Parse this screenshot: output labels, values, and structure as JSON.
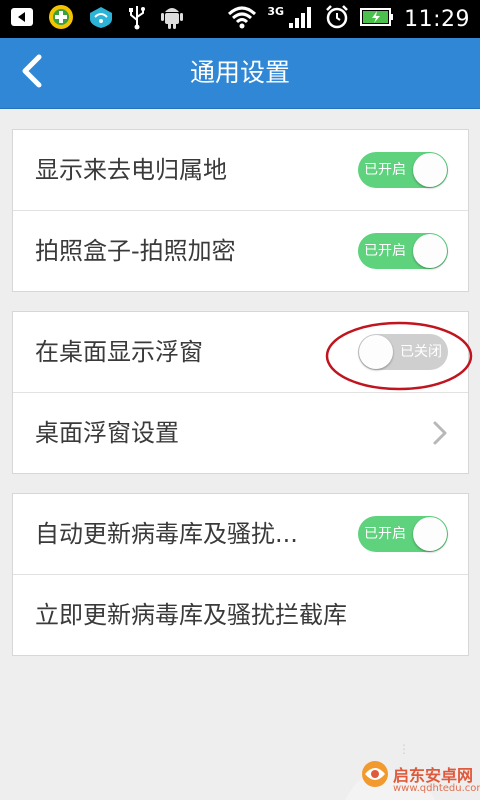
{
  "status_bar": {
    "time": "11:29",
    "network_label": "3G",
    "icons": [
      "back-arrow-icon",
      "360-shield-icon",
      "wifi-lock-icon",
      "usb-icon",
      "android-icon",
      "wifi-icon",
      "signal-icon",
      "alarm-icon",
      "battery-charging-icon"
    ]
  },
  "header": {
    "title": "通用设置",
    "back_icon": "chevron-left-icon"
  },
  "groups": [
    {
      "rows": [
        {
          "label": "显示来去电归属地",
          "toggle": "on",
          "toggle_text": "已开启"
        },
        {
          "label": "拍照盒子-拍照加密",
          "toggle": "on",
          "toggle_text": "已开启"
        }
      ]
    },
    {
      "rows": [
        {
          "label": "在桌面显示浮窗",
          "toggle": "off",
          "toggle_text": "已关闭"
        },
        {
          "label": "桌面浮窗设置",
          "accessory": "chevron-right-icon"
        }
      ]
    },
    {
      "rows": [
        {
          "label": "自动更新病毒库及骚扰...",
          "toggle": "on",
          "toggle_text": "已开启"
        },
        {
          "label": "立即更新病毒库及骚扰拦截库"
        }
      ]
    }
  ],
  "watermark": {
    "name": "启东安卓网",
    "url": "www.qdhtedu.com"
  },
  "colors": {
    "status_bar": "#000000",
    "header": "#2f87d6",
    "background": "#eeeeee",
    "toggle_on": "#5ed27d",
    "toggle_off": "#cfcfcf",
    "highlight": "#c0141e"
  }
}
